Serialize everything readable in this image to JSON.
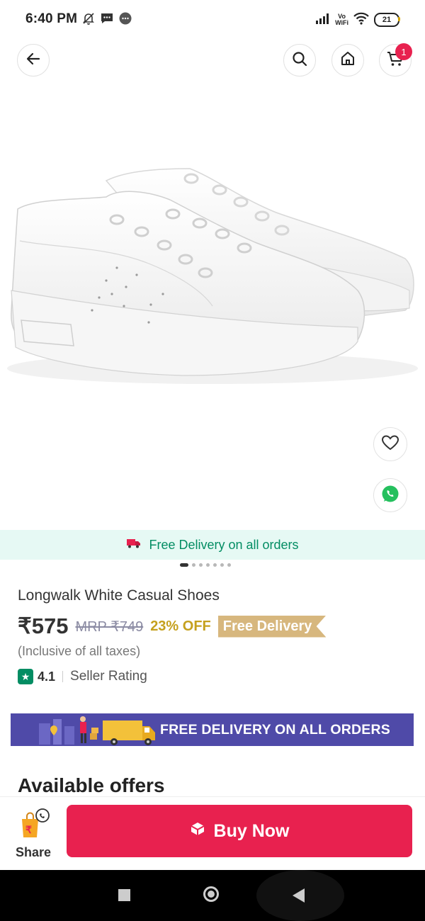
{
  "status_bar": {
    "time": "6:40 PM",
    "vo_line1": "Vo",
    "vo_line2": "WiFi",
    "battery": "21"
  },
  "header": {
    "cart_count": "1"
  },
  "product": {
    "delivery_strip": "Free Delivery on all orders",
    "title": "Longwalk White Casual Shoes",
    "price": "₹575",
    "mrp": "MRP ₹749",
    "discount": "23% OFF",
    "free_delivery_tag": "Free Delivery",
    "tax_note": "(Inclusive of all taxes)",
    "rating": "4.1",
    "rating_label": "Seller Rating",
    "image_count": 7,
    "active_image": 1
  },
  "banner": {
    "text": "FREE DELIVERY ON ALL ORDERS"
  },
  "offers": {
    "title": "Available offers"
  },
  "action_bar": {
    "share_label": "Share",
    "buy_label": "Buy Now"
  },
  "colors": {
    "accent": "#e8214f",
    "green": "#038d63",
    "banner": "#4f4aa8",
    "gold": "#c5a01d"
  }
}
